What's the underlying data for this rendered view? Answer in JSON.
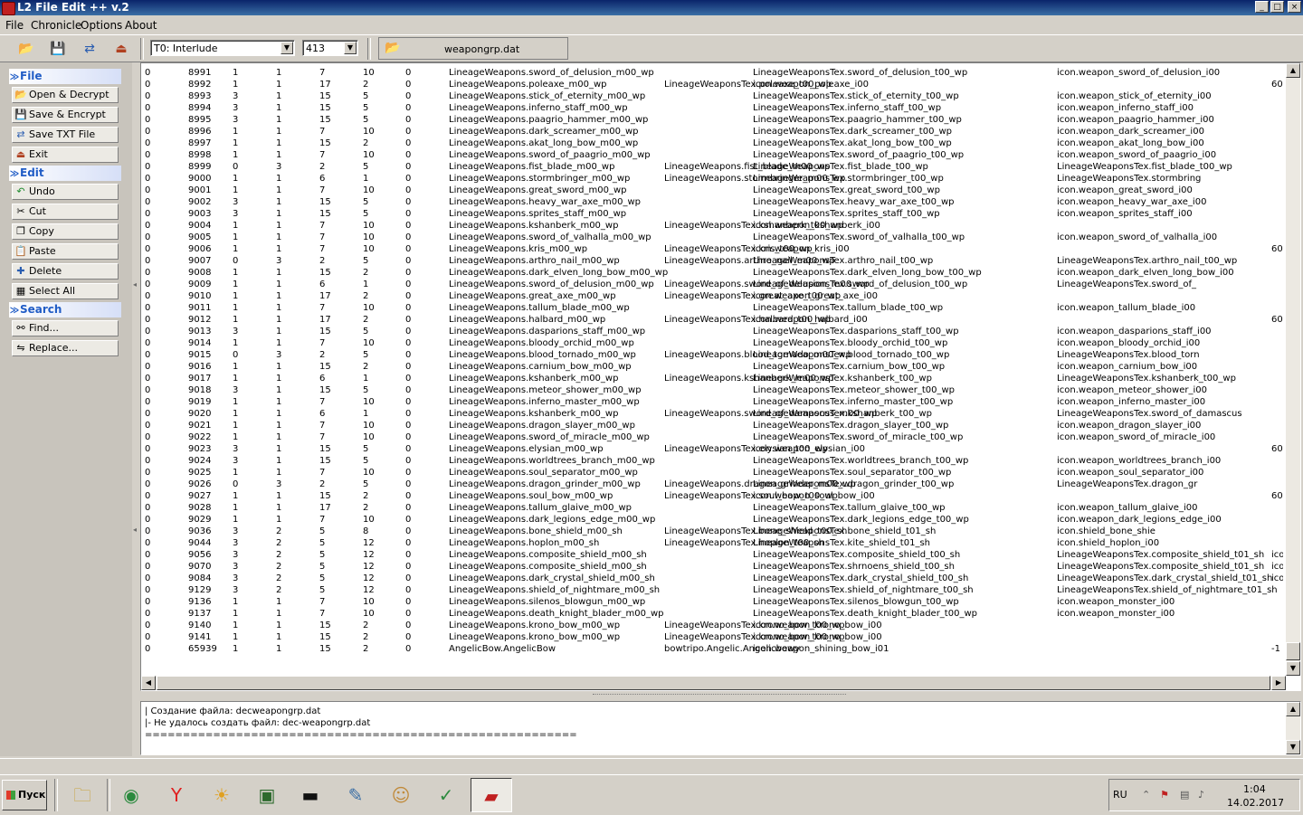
{
  "window": {
    "title": "L2 File Edit ++ v.2",
    "btn_min": "_",
    "btn_max": "□",
    "btn_close": "×"
  },
  "menu": [
    "File",
    "Chronicle",
    "Options",
    "About"
  ],
  "toolbar": {
    "chronicle": "T0: Interlude",
    "protocol": "413",
    "filename": "weapongrp.dat",
    "icons": [
      "open-icon",
      "save-icon",
      "save-txt-icon",
      "exit-icon"
    ]
  },
  "sidebar": {
    "file": {
      "title": "File",
      "items": [
        "Open & Decrypt",
        "Save & Encrypt",
        "Save TXT File",
        "Exit"
      ]
    },
    "edit": {
      "title": "Edit",
      "items": [
        "Undo",
        "Cut",
        "Copy",
        "Paste",
        "Delete",
        "Select All"
      ]
    },
    "search": {
      "title": "Search",
      "items": [
        "Find...",
        "Replace..."
      ]
    }
  },
  "grid": {
    "rows": [
      [
        "0",
        "8991",
        "1",
        "1",
        "7",
        "10",
        "0",
        "LineageWeapons.sword_of_delusion_m00_wp",
        "",
        "LineageWeaponsTex.sword_of_delusion_t00_wp",
        "icon.weapon_sword_of_delusion_i00",
        ""
      ],
      [
        "0",
        "8992",
        "1",
        "1",
        "17",
        "2",
        "0",
        "LineageWeapons.poleaxe_m00_wp",
        "LineageWeaponsTex.poleaxe_t00_wp",
        "icon.weapon_poleaxe_i00",
        "",
        "60"
      ],
      [
        "0",
        "8993",
        "3",
        "1",
        "15",
        "5",
        "0",
        "LineageWeapons.stick_of_eternity_m00_wp",
        "",
        "LineageWeaponsTex.stick_of_eternity_t00_wp",
        "icon.weapon_stick_of_eternity_i00",
        ""
      ],
      [
        "0",
        "8994",
        "3",
        "1",
        "15",
        "5",
        "0",
        "LineageWeapons.inferno_staff_m00_wp",
        "",
        "LineageWeaponsTex.inferno_staff_t00_wp",
        "icon.weapon_inferno_staff_i00",
        ""
      ],
      [
        "0",
        "8995",
        "3",
        "1",
        "15",
        "5",
        "0",
        "LineageWeapons.paagrio_hammer_m00_wp",
        "",
        "LineageWeaponsTex.paagrio_hammer_t00_wp",
        "icon.weapon_paagrio_hammer_i00",
        ""
      ],
      [
        "0",
        "8996",
        "1",
        "1",
        "7",
        "10",
        "0",
        "LineageWeapons.dark_screamer_m00_wp",
        "",
        "LineageWeaponsTex.dark_screamer_t00_wp",
        "icon.weapon_dark_screamer_i00",
        ""
      ],
      [
        "0",
        "8997",
        "1",
        "1",
        "15",
        "2",
        "0",
        "LineageWeapons.akat_long_bow_m00_wp",
        "",
        "LineageWeaponsTex.akat_long_bow_t00_wp",
        "icon.weapon_akat_long_bow_i00",
        ""
      ],
      [
        "0",
        "8998",
        "1",
        "1",
        "7",
        "10",
        "0",
        "LineageWeapons.sword_of_paagrio_m00_wp",
        "",
        "LineageWeaponsTex.sword_of_paagrio_t00_wp",
        "icon.weapon_sword_of_paagrio_i00",
        ""
      ],
      [
        "0",
        "8999",
        "0",
        "3",
        "2",
        "5",
        "0",
        "LineageWeapons.fist_blade_m00_wp",
        "LineageWeapons.fist_blade_m00_wp",
        "LineageWeaponsTex.fist_blade_t00_wp",
        "LineageWeaponsTex.fist_blade_t00_wp",
        ""
      ],
      [
        "0",
        "9000",
        "1",
        "1",
        "6",
        "1",
        "0",
        "LineageWeapons.stormbringer_m00_wp",
        "LineageWeapons.stormbringer_m00_wp",
        "LineageWeaponsTex.stormbringer_t00_wp",
        "LineageWeaponsTex.stormbring",
        ""
      ],
      [
        "0",
        "9001",
        "1",
        "1",
        "7",
        "10",
        "0",
        "LineageWeapons.great_sword_m00_wp",
        "",
        "LineageWeaponsTex.great_sword_t00_wp",
        "icon.weapon_great_sword_i00",
        ""
      ],
      [
        "0",
        "9002",
        "3",
        "1",
        "15",
        "5",
        "0",
        "LineageWeapons.heavy_war_axe_m00_wp",
        "",
        "LineageWeaponsTex.heavy_war_axe_t00_wp",
        "icon.weapon_heavy_war_axe_i00",
        ""
      ],
      [
        "0",
        "9003",
        "3",
        "1",
        "15",
        "5",
        "0",
        "LineageWeapons.sprites_staff_m00_wp",
        "",
        "LineageWeaponsTex.sprites_staff_t00_wp",
        "icon.weapon_sprites_staff_i00",
        ""
      ],
      [
        "0",
        "9004",
        "1",
        "1",
        "7",
        "10",
        "0",
        "LineageWeapons.kshanberk_m00_wp",
        "LineageWeaponsTex.kshanberk_t00_wp",
        "icon.weapon_kshanberk_i00",
        "",
        ""
      ],
      [
        "0",
        "9005",
        "1",
        "1",
        "7",
        "10",
        "0",
        "LineageWeapons.sword_of_valhalla_m00_wp",
        "",
        "LineageWeaponsTex.sword_of_valhalla_t00_wp",
        "icon.weapon_sword_of_valhalla_i00",
        ""
      ],
      [
        "0",
        "9006",
        "1",
        "1",
        "7",
        "10",
        "0",
        "LineageWeapons.kris_m00_wp",
        "LineageWeaponsTex.kris_t00_wp",
        "icon.weapon_kris_i00",
        "",
        "60"
      ],
      [
        "0",
        "9007",
        "0",
        "3",
        "2",
        "5",
        "0",
        "LineageWeapons.arthro_nail_m00_wp",
        "LineageWeapons.arthro_nail_m00_wp",
        "LineageWeaponsTex.arthro_nail_t00_wp",
        "LineageWeaponsTex.arthro_nail_t00_wp",
        ""
      ],
      [
        "0",
        "9008",
        "1",
        "1",
        "15",
        "2",
        "0",
        "LineageWeapons.dark_elven_long_bow_m00_wp",
        "",
        "LineageWeaponsTex.dark_elven_long_bow_t00_wp",
        "icon.weapon_dark_elven_long_bow_i00",
        ""
      ],
      [
        "0",
        "9009",
        "1",
        "1",
        "6",
        "1",
        "0",
        "LineageWeapons.sword_of_delusion_m00_wp",
        "LineageWeapons.sword_of_delusion_m00_wp",
        "LineageWeaponsTex.sword_of_delusion_t00_wp",
        "LineageWeaponsTex.sword_of_",
        ""
      ],
      [
        "0",
        "9010",
        "1",
        "1",
        "17",
        "2",
        "0",
        "LineageWeapons.great_axe_m00_wp",
        "LineageWeaponsTex.great_axe_t00_wp",
        "icon.weapon_great_axe_i00",
        "",
        ""
      ],
      [
        "0",
        "9011",
        "1",
        "1",
        "7",
        "10",
        "0",
        "LineageWeapons.tallum_blade_m00_wp",
        "",
        "LineageWeaponsTex.tallum_blade_t00_wp",
        "icon.weapon_tallum_blade_i00",
        ""
      ],
      [
        "0",
        "9012",
        "1",
        "1",
        "17",
        "2",
        "0",
        "LineageWeapons.halbard_m00_wp",
        "LineageWeaponsTex.halbard_t00_wp",
        "icon.weapon_halbard_i00",
        "",
        "60"
      ],
      [
        "0",
        "9013",
        "3",
        "1",
        "15",
        "5",
        "0",
        "LineageWeapons.dasparions_staff_m00_wp",
        "",
        "LineageWeaponsTex.dasparions_staff_t00_wp",
        "icon.weapon_dasparions_staff_i00",
        ""
      ],
      [
        "0",
        "9014",
        "1",
        "1",
        "7",
        "10",
        "0",
        "LineageWeapons.bloody_orchid_m00_wp",
        "",
        "LineageWeaponsTex.bloody_orchid_t00_wp",
        "icon.weapon_bloody_orchid_i00",
        ""
      ],
      [
        "0",
        "9015",
        "0",
        "3",
        "2",
        "5",
        "0",
        "LineageWeapons.blood_tornado_m00_wp",
        "LineageWeapons.blood_tornado_m00_wp",
        "LineageWeaponsTex.blood_tornado_t00_wp",
        "LineageWeaponsTex.blood_torn",
        ""
      ],
      [
        "0",
        "9016",
        "1",
        "1",
        "15",
        "2",
        "0",
        "LineageWeapons.carnium_bow_m00_wp",
        "",
        "LineageWeaponsTex.carnium_bow_t00_wp",
        "icon.weapon_carnium_bow_i00",
        ""
      ],
      [
        "0",
        "9017",
        "1",
        "1",
        "6",
        "1",
        "0",
        "LineageWeapons.kshanberk_m00_wp",
        "LineageWeapons.kshanberk_m00_wp",
        "LineageWeaponsTex.kshanberk_t00_wp",
        "LineageWeaponsTex.kshanberk_t00_wp",
        ""
      ],
      [
        "0",
        "9018",
        "3",
        "1",
        "15",
        "5",
        "0",
        "LineageWeapons.meteor_shower_m00_wp",
        "",
        "LineageWeaponsTex.meteor_shower_t00_wp",
        "icon.weapon_meteor_shower_i00",
        ""
      ],
      [
        "0",
        "9019",
        "1",
        "1",
        "7",
        "10",
        "0",
        "LineageWeapons.inferno_master_m00_wp",
        "",
        "LineageWeaponsTex.inferno_master_t00_wp",
        "icon.weapon_inferno_master_i00",
        ""
      ],
      [
        "0",
        "9020",
        "1",
        "1",
        "6",
        "1",
        "0",
        "LineageWeapons.kshanberk_m00_wp",
        "LineageWeapons.sword_of_damascus_m00_wp",
        "LineageWeaponsTex.kshanberk_t00_wp",
        "LineageWeaponsTex.sword_of_damascus",
        ""
      ],
      [
        "0",
        "9021",
        "1",
        "1",
        "7",
        "10",
        "0",
        "LineageWeapons.dragon_slayer_m00_wp",
        "",
        "LineageWeaponsTex.dragon_slayer_t00_wp",
        "icon.weapon_dragon_slayer_i00",
        ""
      ],
      [
        "0",
        "9022",
        "1",
        "1",
        "7",
        "10",
        "0",
        "LineageWeapons.sword_of_miracle_m00_wp",
        "",
        "LineageWeaponsTex.sword_of_miracle_t00_wp",
        "icon.weapon_sword_of_miracle_i00",
        ""
      ],
      [
        "0",
        "9023",
        "3",
        "1",
        "15",
        "5",
        "0",
        "LineageWeapons.elysian_m00_wp",
        "LineageWeaponsTex.elysian_t00_wp",
        "icon.weapon_elysian_i00",
        "",
        "60"
      ],
      [
        "0",
        "9024",
        "3",
        "1",
        "15",
        "5",
        "0",
        "LineageWeapons.worldtrees_branch_m00_wp",
        "",
        "LineageWeaponsTex.worldtrees_branch_t00_wp",
        "icon.weapon_worldtrees_branch_i00",
        ""
      ],
      [
        "0",
        "9025",
        "1",
        "1",
        "7",
        "10",
        "0",
        "LineageWeapons.soul_separator_m00_wp",
        "",
        "LineageWeaponsTex.soul_separator_t00_wp",
        "icon.weapon_soul_separator_i00",
        ""
      ],
      [
        "0",
        "9026",
        "0",
        "3",
        "2",
        "5",
        "0",
        "LineageWeapons.dragon_grinder_m00_wp",
        "LineageWeapons.dragon_grinder_m00_wp",
        "LineageWeaponsTex.dragon_grinder_t00_wp",
        "LineageWeaponsTex.dragon_gr",
        ""
      ],
      [
        "0",
        "9027",
        "1",
        "1",
        "15",
        "2",
        "0",
        "LineageWeapons.soul_bow_m00_wp",
        "LineageWeaponsTex.soul_bow_t00_wp",
        "icon.weapon_soul_bow_i00",
        "",
        "60"
      ],
      [
        "0",
        "9028",
        "1",
        "1",
        "17",
        "2",
        "0",
        "LineageWeapons.tallum_glaive_m00_wp",
        "",
        "LineageWeaponsTex.tallum_glaive_t00_wp",
        "icon.weapon_tallum_glaive_i00",
        ""
      ],
      [
        "0",
        "9029",
        "1",
        "1",
        "7",
        "10",
        "0",
        "LineageWeapons.dark_legions_edge_m00_wp",
        "",
        "LineageWeaponsTex.dark_legions_edge_t00_wp",
        "icon.weapon_dark_legions_edge_i00",
        ""
      ],
      [
        "0",
        "9036",
        "3",
        "2",
        "5",
        "8",
        "0",
        "LineageWeapons.bone_shield_m00_sh",
        "LineageWeaponsTex.bone_shield_t00_sh",
        "LineageWeaponsTex.bone_shield_t01_sh",
        "icon.shield_bone_shie",
        ""
      ],
      [
        "0",
        "9044",
        "3",
        "2",
        "5",
        "12",
        "0",
        "LineageWeapons.hoplon_m00_sh",
        "LineageWeaponsTex.hoplon_t00_sh",
        "LineageWeaponsTex.kite_shield_t01_sh",
        "icon.shield_hoplon_i00",
        ""
      ],
      [
        "0",
        "9056",
        "3",
        "2",
        "5",
        "12",
        "0",
        "LineageWeapons.composite_shield_m00_sh",
        "",
        "LineageWeaponsTex.composite_shield_t00_sh",
        "LineageWeaponsTex.composite_shield_t01_sh",
        "icon.shield_"
      ],
      [
        "0",
        "9070",
        "3",
        "2",
        "5",
        "12",
        "0",
        "LineageWeapons.composite_shield_m00_sh",
        "",
        "LineageWeaponsTex.shrnoens_shield_t00_sh",
        "LineageWeaponsTex.composite_shield_t01_sh",
        "icon.shield_"
      ],
      [
        "0",
        "9084",
        "3",
        "2",
        "5",
        "12",
        "0",
        "LineageWeapons.dark_crystal_shield_m00_sh",
        "",
        "LineageWeaponsTex.dark_crystal_shield_t00_sh",
        "LineageWeaponsTex.dark_crystal_shield_t01_sh",
        "icon.shield_"
      ],
      [
        "0",
        "9129",
        "3",
        "2",
        "5",
        "12",
        "0",
        "LineageWeapons.shield_of_nightmare_m00_sh",
        "",
        "LineageWeaponsTex.shield_of_nightmare_t00_sh",
        "LineageWeaponsTex.shield_of_nightmare_t01_sh",
        ""
      ],
      [
        "0",
        "9136",
        "1",
        "1",
        "7",
        "10",
        "0",
        "LineageWeapons.silenos_blowgun_m00_wp",
        "",
        "LineageWeaponsTex.silenos_blowgun_t00_wp",
        "icon.weapon_monster_i00",
        ""
      ],
      [
        "0",
        "9137",
        "1",
        "1",
        "7",
        "10",
        "0",
        "LineageWeapons.death_knight_blader_m00_wp",
        "",
        "LineageWeaponsTex.death_knight_blader_t00_wp",
        "icon.weapon_monster_i00",
        ""
      ],
      [
        "0",
        "9140",
        "1",
        "1",
        "15",
        "2",
        "0",
        "LineageWeapons.krono_bow_m00_wp",
        "LineageWeaponsTex.krono_bow_t00_wp",
        "icon.weapon_krono_bow_i00",
        "",
        ""
      ],
      [
        "0",
        "9141",
        "1",
        "1",
        "15",
        "2",
        "0",
        "LineageWeapons.krono_bow_m00_wp",
        "LineageWeaponsTex.krono_bow_t00_wp",
        "icon.weapon_krono_bow_i00",
        "",
        ""
      ],
      [
        "0",
        "65939",
        "1",
        "1",
        "15",
        "2",
        "0",
        "AngelicBow.AngelicBow",
        "bowtripo.Angelic.Angelicbowy",
        "icon.weapon_shining_bow_i01",
        "",
        "-1"
      ]
    ]
  },
  "log": [
    "|  Создание файла: decweapongrp.dat",
    "|-  Не удалось создать файл: dec-weapongrp.dat",
    "========================================================="
  ],
  "taskbar": {
    "start": "Пуск",
    "apps": [
      "explorer-icon",
      "chrome-icon",
      "yandex-icon",
      "filezilla-icon",
      "monitor-icon",
      "console-icon",
      "notepad-icon",
      "game-icon",
      "chart-icon",
      "l2fileedit-icon"
    ],
    "lang": "RU",
    "time": "1:04",
    "date": "14.02.2017"
  }
}
